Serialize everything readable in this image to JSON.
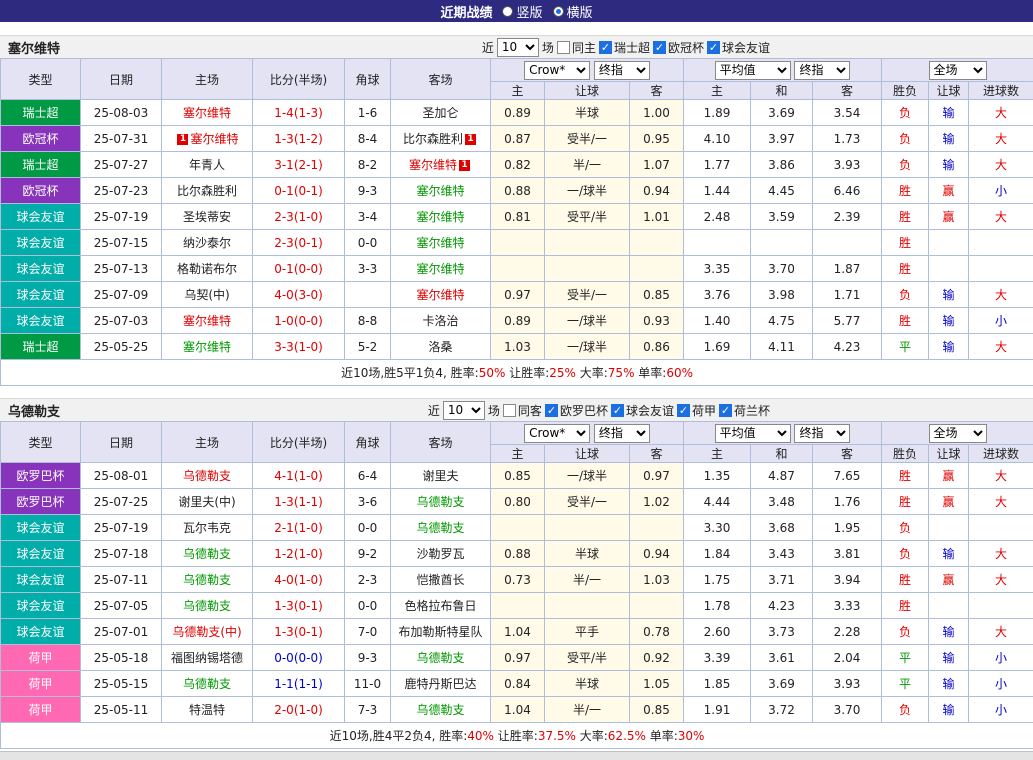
{
  "topbar": {
    "title": "近期战绩",
    "vertical_label": "竖版",
    "horizontal_label": "横版",
    "selected_layout": "横版"
  },
  "palette": {
    "red": "#e10000",
    "green": "#009900",
    "blue": "#0000cc",
    "black": "#222222",
    "accent": "#1b6fe0",
    "topbar_bg": "#2e2a80",
    "header_bg": "#e3e3f3",
    "grid": "#aebdd9",
    "odds_col_bg": "#fffbe8"
  },
  "type_colors": {
    "瑞士超": "#009944",
    "欧冠杯": "#8833bb",
    "球会友谊": "#00ada9",
    "欧罗巴杯": "#8833bb",
    "荷甲": "#ff69b4"
  },
  "table_header": {
    "cols": [
      "类型",
      "日期",
      "主场",
      "比分(半场)",
      "角球",
      "客场"
    ],
    "odds_selects": {
      "source": "Crow*",
      "stage": "终指"
    },
    "avg_selects": {
      "source": "平均值",
      "stage": "终指"
    },
    "full_select": "全场",
    "odds_sub": [
      "主",
      "让球",
      "客"
    ],
    "avg_sub": [
      "主",
      "和",
      "客"
    ],
    "result_sub": [
      "胜负",
      "让球",
      "进球数"
    ]
  },
  "sections": [
    {
      "team": "塞尔维特",
      "filter": {
        "prefix": "近",
        "count": "10",
        "suffix": "场",
        "same": "同主",
        "same_checked": false,
        "leagues": [
          "瑞士超",
          "欧冠杯",
          "球会友谊"
        ]
      },
      "rows": [
        {
          "type": "瑞士超",
          "date": "25-08-03",
          "home": [
            "塞尔维特",
            "red",
            ""
          ],
          "score": [
            "1-4(1-3)",
            "red"
          ],
          "corner": "1-6",
          "away": [
            "圣加仑",
            "black",
            ""
          ],
          "odds": [
            "0.89",
            "半球",
            "1.00"
          ],
          "avg": [
            "1.89",
            "3.69",
            "3.54"
          ],
          "res": [
            [
              "负",
              "red"
            ],
            [
              "输",
              "blue"
            ],
            [
              "大",
              "red"
            ]
          ]
        },
        {
          "type": "欧冠杯",
          "date": "25-07-31",
          "home": [
            "塞尔维特",
            "red",
            "before"
          ],
          "score": [
            "1-3(1-2)",
            "red"
          ],
          "corner": "8-4",
          "away": [
            "比尔森胜利",
            "black",
            "after"
          ],
          "odds": [
            "0.87",
            "受半/一",
            "0.95"
          ],
          "avg": [
            "4.10",
            "3.97",
            "1.73"
          ],
          "res": [
            [
              "负",
              "red"
            ],
            [
              "输",
              "blue"
            ],
            [
              "大",
              "red"
            ]
          ]
        },
        {
          "type": "瑞士超",
          "date": "25-07-27",
          "home": [
            "年青人",
            "black",
            ""
          ],
          "score": [
            "3-1(2-1)",
            "red"
          ],
          "corner": "8-2",
          "away": [
            "塞尔维特",
            "red",
            "after"
          ],
          "odds": [
            "0.82",
            "半/一",
            "1.07"
          ],
          "avg": [
            "1.77",
            "3.86",
            "3.93"
          ],
          "res": [
            [
              "负",
              "red"
            ],
            [
              "输",
              "blue"
            ],
            [
              "大",
              "red"
            ]
          ]
        },
        {
          "type": "欧冠杯",
          "date": "25-07-23",
          "home": [
            "比尔森胜利",
            "black",
            ""
          ],
          "score": [
            "0-1(0-1)",
            "red"
          ],
          "corner": "9-3",
          "away": [
            "塞尔维特",
            "green",
            ""
          ],
          "odds": [
            "0.88",
            "一/球半",
            "0.94"
          ],
          "avg": [
            "1.44",
            "4.45",
            "6.46"
          ],
          "res": [
            [
              "胜",
              "red"
            ],
            [
              "赢",
              "red"
            ],
            [
              "小",
              "blue"
            ]
          ]
        },
        {
          "type": "球会友谊",
          "date": "25-07-19",
          "home": [
            "圣埃蒂安",
            "black",
            ""
          ],
          "score": [
            "2-3(1-0)",
            "red"
          ],
          "corner": "3-4",
          "away": [
            "塞尔维特",
            "green",
            ""
          ],
          "odds": [
            "0.81",
            "受平/半",
            "1.01"
          ],
          "avg": [
            "2.48",
            "3.59",
            "2.39"
          ],
          "res": [
            [
              "胜",
              "red"
            ],
            [
              "赢",
              "red"
            ],
            [
              "大",
              "red"
            ]
          ]
        },
        {
          "type": "球会友谊",
          "date": "25-07-15",
          "home": [
            "纳沙泰尔",
            "black",
            ""
          ],
          "score": [
            "2-3(0-1)",
            "red"
          ],
          "corner": "0-0",
          "away": [
            "塞尔维特",
            "green",
            ""
          ],
          "odds": [
            "",
            "",
            ""
          ],
          "avg": [
            "",
            "",
            ""
          ],
          "res": [
            [
              "胜",
              "red"
            ],
            [
              "",
              ""
            ],
            [
              "",
              ""
            ]
          ]
        },
        {
          "type": "球会友谊",
          "date": "25-07-13",
          "home": [
            "格勒诺布尔",
            "black",
            ""
          ],
          "score": [
            "0-1(0-0)",
            "red"
          ],
          "corner": "3-3",
          "away": [
            "塞尔维特",
            "green",
            ""
          ],
          "odds": [
            "",
            "",
            ""
          ],
          "avg": [
            "3.35",
            "3.70",
            "1.87"
          ],
          "res": [
            [
              "胜",
              "red"
            ],
            [
              "",
              ""
            ],
            [
              "",
              ""
            ]
          ]
        },
        {
          "type": "球会友谊",
          "date": "25-07-09",
          "home": [
            "乌契(中)",
            "black",
            ""
          ],
          "score": [
            "4-0(3-0)",
            "red"
          ],
          "corner": "",
          "away": [
            "塞尔维特",
            "red",
            ""
          ],
          "odds": [
            "0.97",
            "受半/一",
            "0.85"
          ],
          "avg": [
            "3.76",
            "3.98",
            "1.71"
          ],
          "res": [
            [
              "负",
              "red"
            ],
            [
              "输",
              "blue"
            ],
            [
              "大",
              "red"
            ]
          ]
        },
        {
          "type": "球会友谊",
          "date": "25-07-03",
          "home": [
            "塞尔维特",
            "red",
            ""
          ],
          "score": [
            "1-0(0-0)",
            "red"
          ],
          "corner": "8-8",
          "away": [
            "卡洛治",
            "black",
            ""
          ],
          "odds": [
            "0.89",
            "一/球半",
            "0.93"
          ],
          "avg": [
            "1.40",
            "4.75",
            "5.77"
          ],
          "res": [
            [
              "胜",
              "red"
            ],
            [
              "输",
              "blue"
            ],
            [
              "小",
              "blue"
            ]
          ]
        },
        {
          "type": "瑞士超",
          "date": "25-05-25",
          "home": [
            "塞尔维特",
            "green",
            ""
          ],
          "score": [
            "3-3(1-0)",
            "red"
          ],
          "corner": "5-2",
          "away": [
            "洛桑",
            "black",
            ""
          ],
          "odds": [
            "1.03",
            "一/球半",
            "0.86"
          ],
          "avg": [
            "1.69",
            "4.11",
            "4.23"
          ],
          "res": [
            [
              "平",
              "green"
            ],
            [
              "输",
              "blue"
            ],
            [
              "大",
              "red"
            ]
          ]
        }
      ],
      "summary": [
        {
          "text": "近10场,胜5平1负4, 胜率:",
          "color": "black"
        },
        {
          "text": "50%",
          "color": "red"
        },
        {
          "text": " 让胜率:",
          "color": "black"
        },
        {
          "text": "25%",
          "color": "red"
        },
        {
          "text": " 大率:",
          "color": "black"
        },
        {
          "text": "75%",
          "color": "red"
        },
        {
          "text": " 单率:",
          "color": "black"
        },
        {
          "text": "60%",
          "color": "red"
        }
      ]
    },
    {
      "team": "乌德勒支",
      "filter": {
        "prefix": "近",
        "count": "10",
        "suffix": "场",
        "same": "同客",
        "same_checked": false,
        "leagues": [
          "欧罗巴杯",
          "球会友谊",
          "荷甲",
          "荷兰杯"
        ]
      },
      "rows": [
        {
          "type": "欧罗巴杯",
          "date": "25-08-01",
          "home": [
            "乌德勒支",
            "red",
            ""
          ],
          "score": [
            "4-1(1-0)",
            "red"
          ],
          "corner": "6-4",
          "away": [
            "谢里夫",
            "black",
            ""
          ],
          "odds": [
            "0.85",
            "一/球半",
            "0.97"
          ],
          "avg": [
            "1.35",
            "4.87",
            "7.65"
          ],
          "res": [
            [
              "胜",
              "red"
            ],
            [
              "赢",
              "red"
            ],
            [
              "大",
              "red"
            ]
          ]
        },
        {
          "type": "欧罗巴杯",
          "date": "25-07-25",
          "home": [
            "谢里夫(中)",
            "black",
            ""
          ],
          "score": [
            "1-3(1-1)",
            "red"
          ],
          "corner": "3-6",
          "away": [
            "乌德勒支",
            "green",
            ""
          ],
          "odds": [
            "0.80",
            "受半/一",
            "1.02"
          ],
          "avg": [
            "4.44",
            "3.48",
            "1.76"
          ],
          "res": [
            [
              "胜",
              "red"
            ],
            [
              "赢",
              "red"
            ],
            [
              "大",
              "red"
            ]
          ]
        },
        {
          "type": "球会友谊",
          "date": "25-07-19",
          "home": [
            "瓦尔韦克",
            "black",
            ""
          ],
          "score": [
            "2-1(1-0)",
            "red"
          ],
          "corner": "0-0",
          "away": [
            "乌德勒支",
            "green",
            ""
          ],
          "odds": [
            "",
            "",
            ""
          ],
          "avg": [
            "3.30",
            "3.68",
            "1.95"
          ],
          "res": [
            [
              "负",
              "red"
            ],
            [
              "",
              ""
            ],
            [
              "",
              ""
            ]
          ]
        },
        {
          "type": "球会友谊",
          "date": "25-07-18",
          "home": [
            "乌德勒支",
            "green",
            ""
          ],
          "score": [
            "1-2(1-0)",
            "red"
          ],
          "corner": "9-2",
          "away": [
            "沙勒罗瓦",
            "black",
            ""
          ],
          "odds": [
            "0.88",
            "半球",
            "0.94"
          ],
          "avg": [
            "1.84",
            "3.43",
            "3.81"
          ],
          "res": [
            [
              "负",
              "red"
            ],
            [
              "输",
              "blue"
            ],
            [
              "大",
              "red"
            ]
          ]
        },
        {
          "type": "球会友谊",
          "date": "25-07-11",
          "home": [
            "乌德勒支",
            "green",
            ""
          ],
          "score": [
            "4-0(1-0)",
            "red"
          ],
          "corner": "2-3",
          "away": [
            "恺撒酋长",
            "black",
            ""
          ],
          "odds": [
            "0.73",
            "半/一",
            "1.03"
          ],
          "avg": [
            "1.75",
            "3.71",
            "3.94"
          ],
          "res": [
            [
              "胜",
              "red"
            ],
            [
              "赢",
              "red"
            ],
            [
              "大",
              "red"
            ]
          ]
        },
        {
          "type": "球会友谊",
          "date": "25-07-05",
          "home": [
            "乌德勒支",
            "green",
            ""
          ],
          "score": [
            "1-3(0-1)",
            "red"
          ],
          "corner": "0-0",
          "away": [
            "色格拉布鲁日",
            "black",
            ""
          ],
          "odds": [
            "",
            "",
            ""
          ],
          "avg": [
            "1.78",
            "4.23",
            "3.33"
          ],
          "res": [
            [
              "胜",
              "red"
            ],
            [
              "",
              ""
            ],
            [
              "",
              ""
            ]
          ]
        },
        {
          "type": "球会友谊",
          "date": "25-07-01",
          "home": [
            "乌德勒支(中)",
            "red",
            ""
          ],
          "score": [
            "1-3(0-1)",
            "red"
          ],
          "corner": "7-0",
          "away": [
            "布加勒斯特星队",
            "black",
            ""
          ],
          "odds": [
            "1.04",
            "平手",
            "0.78"
          ],
          "avg": [
            "2.60",
            "3.73",
            "2.28"
          ],
          "res": [
            [
              "负",
              "red"
            ],
            [
              "输",
              "blue"
            ],
            [
              "大",
              "red"
            ]
          ]
        },
        {
          "type": "荷甲",
          "date": "25-05-18",
          "home": [
            "福图纳锡塔德",
            "black",
            ""
          ],
          "score": [
            "0-0(0-0)",
            "blue"
          ],
          "corner": "9-3",
          "away": [
            "乌德勒支",
            "green",
            ""
          ],
          "odds": [
            "0.97",
            "受平/半",
            "0.92"
          ],
          "avg": [
            "3.39",
            "3.61",
            "2.04"
          ],
          "res": [
            [
              "平",
              "green"
            ],
            [
              "输",
              "blue"
            ],
            [
              "小",
              "blue"
            ]
          ]
        },
        {
          "type": "荷甲",
          "date": "25-05-15",
          "home": [
            "乌德勒支",
            "green",
            ""
          ],
          "score": [
            "1-1(1-1)",
            "blue"
          ],
          "corner": "11-0",
          "away": [
            "鹿特丹斯巴达",
            "black",
            ""
          ],
          "odds": [
            "0.84",
            "半球",
            "1.05"
          ],
          "avg": [
            "1.85",
            "3.69",
            "3.93"
          ],
          "res": [
            [
              "平",
              "green"
            ],
            [
              "输",
              "blue"
            ],
            [
              "小",
              "blue"
            ]
          ]
        },
        {
          "type": "荷甲",
          "date": "25-05-11",
          "home": [
            "特温特",
            "black",
            ""
          ],
          "score": [
            "2-0(1-0)",
            "red"
          ],
          "corner": "7-3",
          "away": [
            "乌德勒支",
            "green",
            ""
          ],
          "odds": [
            "1.04",
            "半/一",
            "0.85"
          ],
          "avg": [
            "1.91",
            "3.72",
            "3.70"
          ],
          "res": [
            [
              "负",
              "red"
            ],
            [
              "输",
              "blue"
            ],
            [
              "小",
              "blue"
            ]
          ]
        }
      ],
      "summary": [
        {
          "text": "近10场,胜4平2负4, 胜率:",
          "color": "black"
        },
        {
          "text": "40%",
          "color": "red"
        },
        {
          "text": " 让胜率:",
          "color": "black"
        },
        {
          "text": "37.5%",
          "color": "red"
        },
        {
          "text": " 大率:",
          "color": "black"
        },
        {
          "text": "62.5%",
          "color": "red"
        },
        {
          "text": " 单率:",
          "color": "black"
        },
        {
          "text": "30%",
          "color": "red"
        }
      ]
    }
  ]
}
